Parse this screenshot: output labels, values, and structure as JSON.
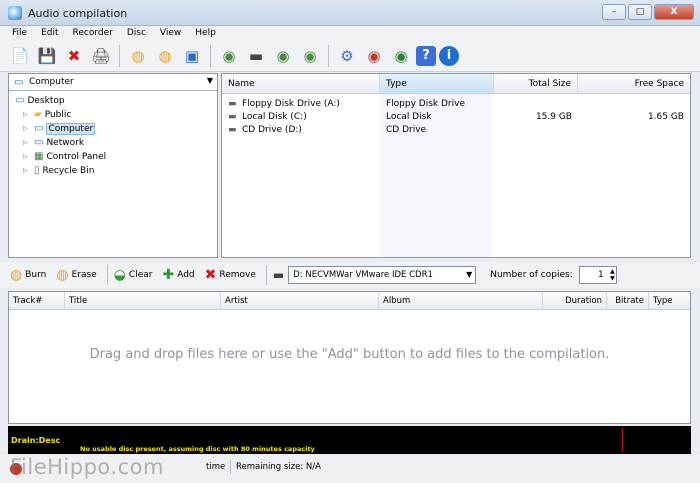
{
  "window": {
    "title": "Audio compilation",
    "buttons": {
      "minimize": "–",
      "maximize": "□",
      "close": "X"
    }
  },
  "menu": [
    "File",
    "Edit",
    "Recorder",
    "Disc",
    "View",
    "Help"
  ],
  "toolbar_icons": [
    {
      "name": "new-icon",
      "glyph": "📄",
      "color": "#d9b43a"
    },
    {
      "name": "save-icon",
      "glyph": "💾",
      "color": "#2b5fae"
    },
    {
      "name": "delete-icon",
      "glyph": "✖",
      "color": "#d41b1b"
    },
    {
      "name": "print-icon",
      "glyph": "🖨",
      "color": "#555555"
    },
    {
      "name": "burn-disc-icon",
      "glyph": "◍",
      "color": "#e2a62c"
    },
    {
      "name": "erase-disc-icon",
      "glyph": "◍",
      "color": "#e2a62c"
    },
    {
      "name": "window-icon",
      "glyph": "▣",
      "color": "#2e6cc9"
    },
    {
      "name": "globe-icon",
      "glyph": "◉",
      "color": "#4c8c3f"
    },
    {
      "name": "drive-icon",
      "glyph": "▬",
      "color": "#444444"
    },
    {
      "name": "disc-copy-icon",
      "glyph": "◉",
      "color": "#4c8c3f"
    },
    {
      "name": "disc-info-icon",
      "glyph": "◉",
      "color": "#4c8c3f"
    },
    {
      "name": "settings-icon",
      "glyph": "⚙",
      "color": "#3a6fd8"
    },
    {
      "name": "web-icon",
      "glyph": "◉",
      "color": "#c0392b"
    },
    {
      "name": "update-icon",
      "glyph": "◉",
      "color": "#2e7d32"
    },
    {
      "name": "help-icon",
      "glyph": "?",
      "color": "#3a6fd8"
    },
    {
      "name": "info-icon",
      "glyph": "i",
      "color": "#1f6fd0"
    }
  ],
  "tree": {
    "combo_value": "Computer",
    "items": [
      {
        "label": "Desktop",
        "level": 0,
        "icon": "desktop-icon",
        "glyph": "▭",
        "color": "#2e6cc9"
      },
      {
        "label": "Public",
        "level": 1,
        "icon": "folder-icon",
        "glyph": "▰",
        "color": "#e5b83a"
      },
      {
        "label": "Computer",
        "level": 1,
        "icon": "computer-icon",
        "glyph": "▭",
        "color": "#2e6cc9",
        "selected": true
      },
      {
        "label": "Network",
        "level": 1,
        "icon": "network-icon",
        "glyph": "▭",
        "color": "#2e6cc9"
      },
      {
        "label": "Control Panel",
        "level": 1,
        "icon": "control-panel-icon",
        "glyph": "▦",
        "color": "#3a7c3a"
      },
      {
        "label": "Recycle Bin",
        "level": 1,
        "icon": "recycle-bin-icon",
        "glyph": "▯",
        "color": "#666666"
      }
    ]
  },
  "drives": {
    "columns": [
      "Name",
      "Type",
      "Total Size",
      "Free Space"
    ],
    "rows": [
      {
        "name": "Floppy Disk Drive (A:)",
        "type": "Floppy Disk Drive",
        "total": "",
        "free": ""
      },
      {
        "name": "Local Disk (C:)",
        "type": "Local Disk",
        "total": "15.9 GB",
        "free": "1.65 GB"
      },
      {
        "name": "CD Drive (D:)",
        "type": "CD Drive",
        "total": "",
        "free": ""
      }
    ]
  },
  "burnbar": {
    "burn": "Burn",
    "erase": "Erase",
    "clear": "Clear",
    "add": "Add",
    "remove": "Remove",
    "drive": "D: NECVMWar VMware IDE CDR1",
    "copies_label": "Number of copies:",
    "copies_value": "1"
  },
  "tracks": {
    "columns": [
      "Track#",
      "Title",
      "Artist",
      "Album",
      "Duration",
      "Bitrate",
      "Type"
    ],
    "empty_hint": "Drag and drop files here or use the \"Add\" button to add files to the compilation."
  },
  "log": {
    "line1": "Drain:Desc",
    "line2_message": "No usable disc present, assuming disc with 80 minutes capacity"
  },
  "status": {
    "time_suffix": "time",
    "remaining": "Remaining size: N/A",
    "watermark": "FileHippo.com"
  }
}
